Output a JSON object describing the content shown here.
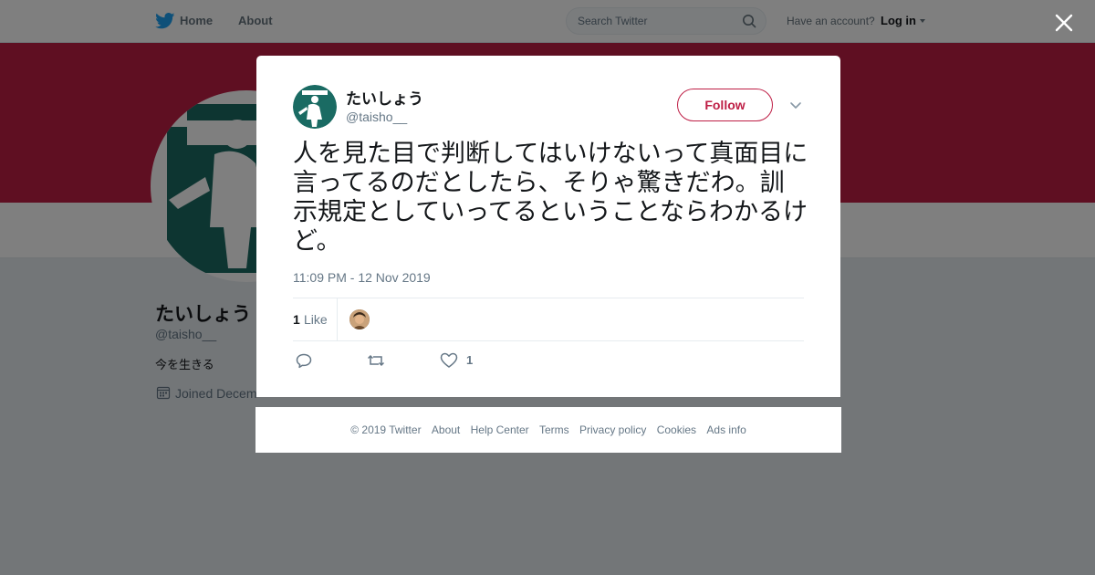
{
  "nav": {
    "home": "Home",
    "about": "About",
    "search_placeholder": "Search Twitter",
    "have_account": "Have an account?",
    "login": "Log in"
  },
  "profile": {
    "name": "たいしょう",
    "handle": "@taisho__",
    "bio": "今を生きる",
    "joined": "Joined Decem"
  },
  "tweet": {
    "author_name": "たいしょう",
    "author_handle": "@taisho__",
    "follow_label": "Follow",
    "text": "人を見た目で判断してはいけないって真面目に言ってるのだとしたら、そりゃ驚きだわ。訓示規定としていってるということならわかるけど。",
    "timestamp": "11:09 PM - 12 Nov 2019",
    "like_count": "1",
    "like_label": "Like",
    "action_like_count": "1"
  },
  "footer": {
    "links": [
      "© 2019 Twitter",
      "About",
      "Help Center",
      "Terms",
      "Privacy policy",
      "Cookies",
      "Ads info"
    ]
  },
  "colors": {
    "accent": "#be1e45",
    "avatar_green": "#1a6b63"
  },
  "icons": {
    "close": "close-icon",
    "search": "search-icon",
    "bird": "twitter-bird-icon",
    "reply": "reply-icon",
    "retweet": "retweet-icon",
    "like": "heart-icon",
    "dropdown": "chevron-down-icon",
    "calendar": "calendar-icon"
  }
}
